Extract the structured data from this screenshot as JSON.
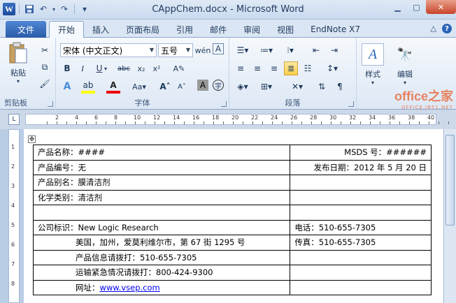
{
  "window": {
    "title": "CAppChem.docx - Microsoft Word",
    "app_logo": "W"
  },
  "qat": {
    "save": "💾",
    "undo": "↶",
    "redo": "↷",
    "customize": "▾"
  },
  "tabs": {
    "file": "文件",
    "items": [
      "开始",
      "插入",
      "页面布局",
      "引用",
      "邮件",
      "审阅",
      "视图",
      "EndNote X7"
    ]
  },
  "ribbon": {
    "clipboard": {
      "label": "剪贴板",
      "paste": "粘贴"
    },
    "font": {
      "label": "字体",
      "family": "宋体 (中文正文)",
      "size": "五号"
    },
    "paragraph": {
      "label": "段落"
    },
    "styles": {
      "label": "样式"
    },
    "editing": {
      "label": "编辑"
    }
  },
  "watermark": {
    "line1": "office之家",
    "line2": "OFFICE.JB51.NET"
  },
  "ruler": {
    "ticks": [
      "2",
      "4",
      "6",
      "8",
      "10",
      "12",
      "14",
      "16",
      "18",
      "20",
      "22",
      "24",
      "26",
      "28",
      "30",
      "32",
      "34",
      "36",
      "38",
      "40"
    ],
    "vticks": [
      "1",
      "2",
      "3",
      "4",
      "5",
      "6",
      "7",
      "8"
    ]
  },
  "document": {
    "rows": [
      {
        "left": "产品名称：####",
        "right": "MSDS 号：######",
        "right_align": "right"
      },
      {
        "left": "产品编号：无",
        "right": "发布日期：2012 年 5 月 20 日",
        "right_align": "right"
      },
      {
        "left": "产品别名：膜清洁剂",
        "right": ""
      },
      {
        "left": "化学类别：清洁剂",
        "right": ""
      },
      {
        "left": "",
        "right": ""
      },
      {
        "left": "公司标识：New Logic Research",
        "right": "电话：510-655-7305"
      },
      {
        "left": "美国，加州，爱莫利维尔市，第 67 街 1295 号",
        "right": "传真：510-655-7305",
        "indent": true
      },
      {
        "left": "产品信息请拨打：510-655-7305",
        "right": "",
        "indent": true
      },
      {
        "left": "运输紧急情况请拨打：800-424-9300",
        "right": "",
        "indent": true
      },
      {
        "left_prefix": "网址：",
        "left_link": "www.vsep.com",
        "right": "",
        "indent": true
      }
    ]
  }
}
